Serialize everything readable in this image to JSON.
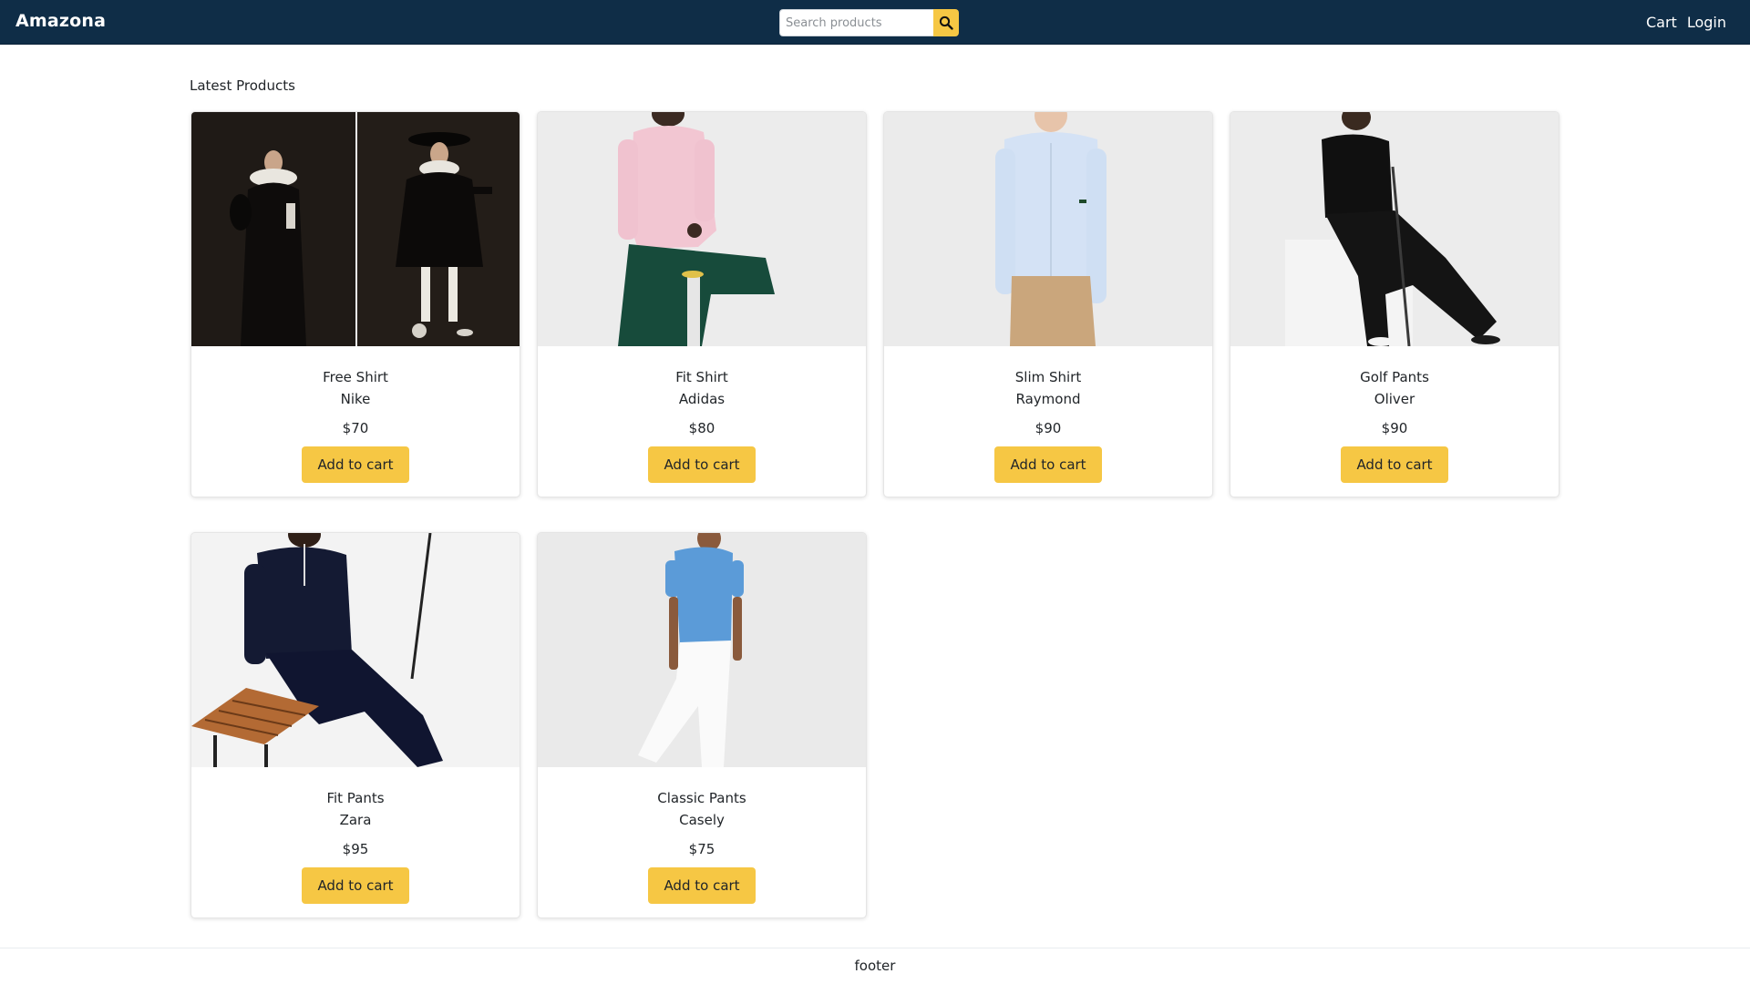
{
  "header": {
    "brand": "Amazona",
    "search": {
      "placeholder": "Search products",
      "value": ""
    },
    "search_icon": "search-icon",
    "links": [
      "Cart",
      "Login"
    ]
  },
  "main": {
    "title": "Latest Products",
    "products": [
      {
        "name": "Free Shirt",
        "brand": "Nike",
        "price": "$70",
        "button": "Add to cart"
      },
      {
        "name": "Fit Shirt",
        "brand": "Adidas",
        "price": "$80",
        "button": "Add to cart"
      },
      {
        "name": "Slim Shirt",
        "brand": "Raymond",
        "price": "$90",
        "button": "Add to cart"
      },
      {
        "name": "Golf Pants",
        "brand": "Oliver",
        "price": "$90",
        "button": "Add to cart"
      },
      {
        "name": "Fit Pants",
        "brand": "Zara",
        "price": "$95",
        "button": "Add to cart"
      },
      {
        "name": "Classic Pants",
        "brand": "Casely",
        "price": "$75",
        "button": "Add to cart"
      }
    ]
  },
  "footer": {
    "text": "footer"
  },
  "colors": {
    "navbar": "#0f2d47",
    "accent": "#f6c744",
    "background": "#ffffff"
  }
}
